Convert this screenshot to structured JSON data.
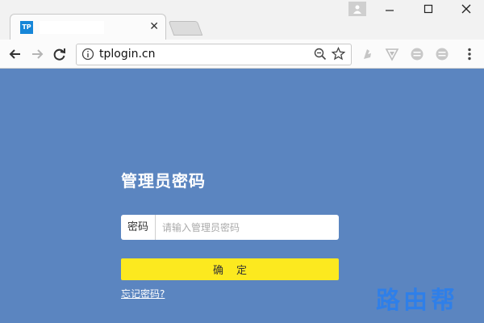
{
  "browser": {
    "tab": {
      "favicon_text": "TP",
      "close_glyph": "✕"
    },
    "address_bar": {
      "url": "tplogin.cn"
    },
    "window_controls": {
      "minimize": "—",
      "maximize": "☐",
      "close": "✕"
    },
    "icons": [
      "back-icon",
      "forward-icon",
      "reload-icon",
      "info-icon",
      "zoom-icon",
      "star-icon",
      "extension-icon",
      "shield-icon",
      "menu-icon"
    ]
  },
  "login": {
    "title": "管理员密码",
    "password_label": "密码",
    "password_placeholder": "请输入管理员密码",
    "password_value": "",
    "confirm_label": "确定",
    "forgot_label": "忘记密码?"
  },
  "watermark": {
    "text": "路由帮"
  },
  "colors": {
    "page_bg": "#5b85c0",
    "button": "#fce91f",
    "watermark": "#2f7fe8"
  }
}
